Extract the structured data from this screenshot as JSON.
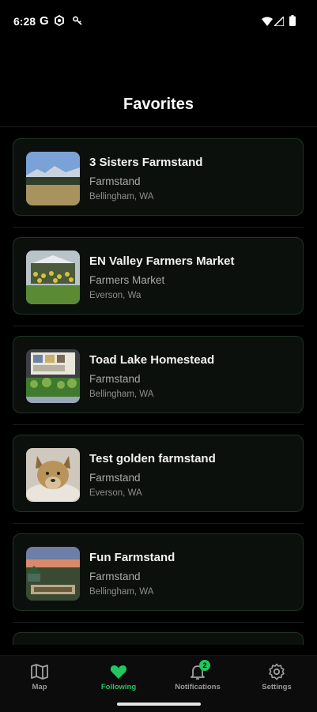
{
  "status_bar": {
    "time": "6:28",
    "g_label": "G"
  },
  "header": {
    "title": "Favorites"
  },
  "favorites": [
    {
      "name": "3 Sisters Farmstand",
      "type": "Farmstand",
      "location": "Bellingham, WA"
    },
    {
      "name": "EN Valley Farmers Market",
      "type": "Farmers Market",
      "location": "Everson, Wa"
    },
    {
      "name": "Toad Lake Homestead",
      "type": "Farmstand",
      "location": "Bellingham, WA"
    },
    {
      "name": "Test golden farmstand",
      "type": "Farmstand",
      "location": "Everson, WA"
    },
    {
      "name": "Fun Farmstand",
      "type": "Farmstand",
      "location": "Bellingham, WA"
    }
  ],
  "nav": {
    "map_label": "Map",
    "following_label": "Following",
    "notifications_label": "Notifications",
    "notifications_count": "2",
    "settings_label": "Settings"
  },
  "colors": {
    "accent": "#22c55e",
    "background": "#000000",
    "card_border": "#1f3524"
  }
}
